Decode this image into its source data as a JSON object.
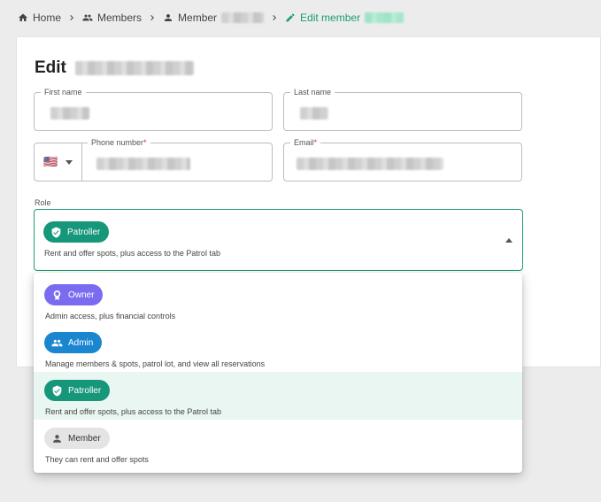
{
  "breadcrumb": {
    "home": "Home",
    "members": "Members",
    "member": "Member",
    "edit": "Edit member"
  },
  "page": {
    "title": "Edit"
  },
  "form": {
    "first_name_label": "First name",
    "last_name_label": "Last name",
    "phone_label": "Phone number",
    "phone_required": "*",
    "phone_country_flag": "🇺🇸",
    "email_label": "Email",
    "email_required": "*",
    "role_label": "Role"
  },
  "role": {
    "selected": {
      "label": "Patroller",
      "description": "Rent and offer spots, plus access to the Patrol tab"
    }
  },
  "dropdown": {
    "options": [
      {
        "label": "Owner",
        "description": "Admin access, plus financial controls",
        "icon": "award-icon",
        "color": "#7a6cf0"
      },
      {
        "label": "Admin",
        "description": "Manage members & spots, patrol lot, and view all reservations",
        "icon": "people-icon",
        "color": "#1a86d0"
      },
      {
        "label": "Patroller",
        "description": "Rent and offer spots, plus access to the Patrol tab",
        "icon": "shield-check-icon",
        "color": "#16977a"
      },
      {
        "label": "Member",
        "description": "They can rent and offer spots",
        "icon": "person-icon",
        "color": "#e4e4e4"
      }
    ]
  },
  "colors": {
    "accent": "#1a9c75"
  }
}
